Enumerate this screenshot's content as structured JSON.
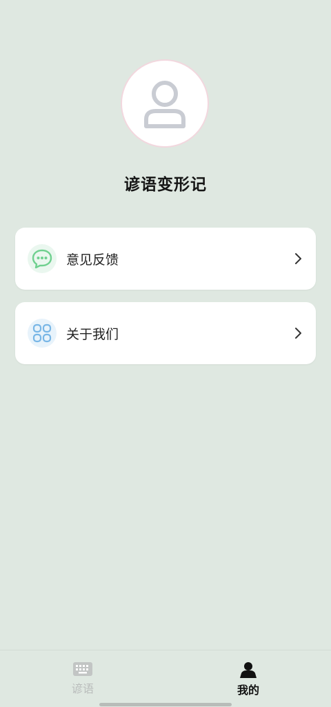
{
  "profile": {
    "avatar_icon": "user-outline-icon",
    "app_name": "谚语变形记"
  },
  "menu": [
    {
      "label": "意见反馈",
      "icon": "chat-bubble-icon",
      "icon_color": "#6fd08f"
    },
    {
      "label": "关于我们",
      "icon": "grid-apps-icon",
      "icon_color": "#78b6e6"
    }
  ],
  "tabbar": {
    "tabs": [
      {
        "label": "谚语",
        "icon": "keyboard-icon",
        "active": false
      },
      {
        "label": "我的",
        "icon": "person-icon",
        "active": true
      }
    ]
  },
  "colors": {
    "background": "#dfe8e1",
    "card": "#ffffff",
    "avatar_border": "#f2d7de",
    "tab_inactive": "#b9bcbb",
    "tab_active": "#111111"
  }
}
